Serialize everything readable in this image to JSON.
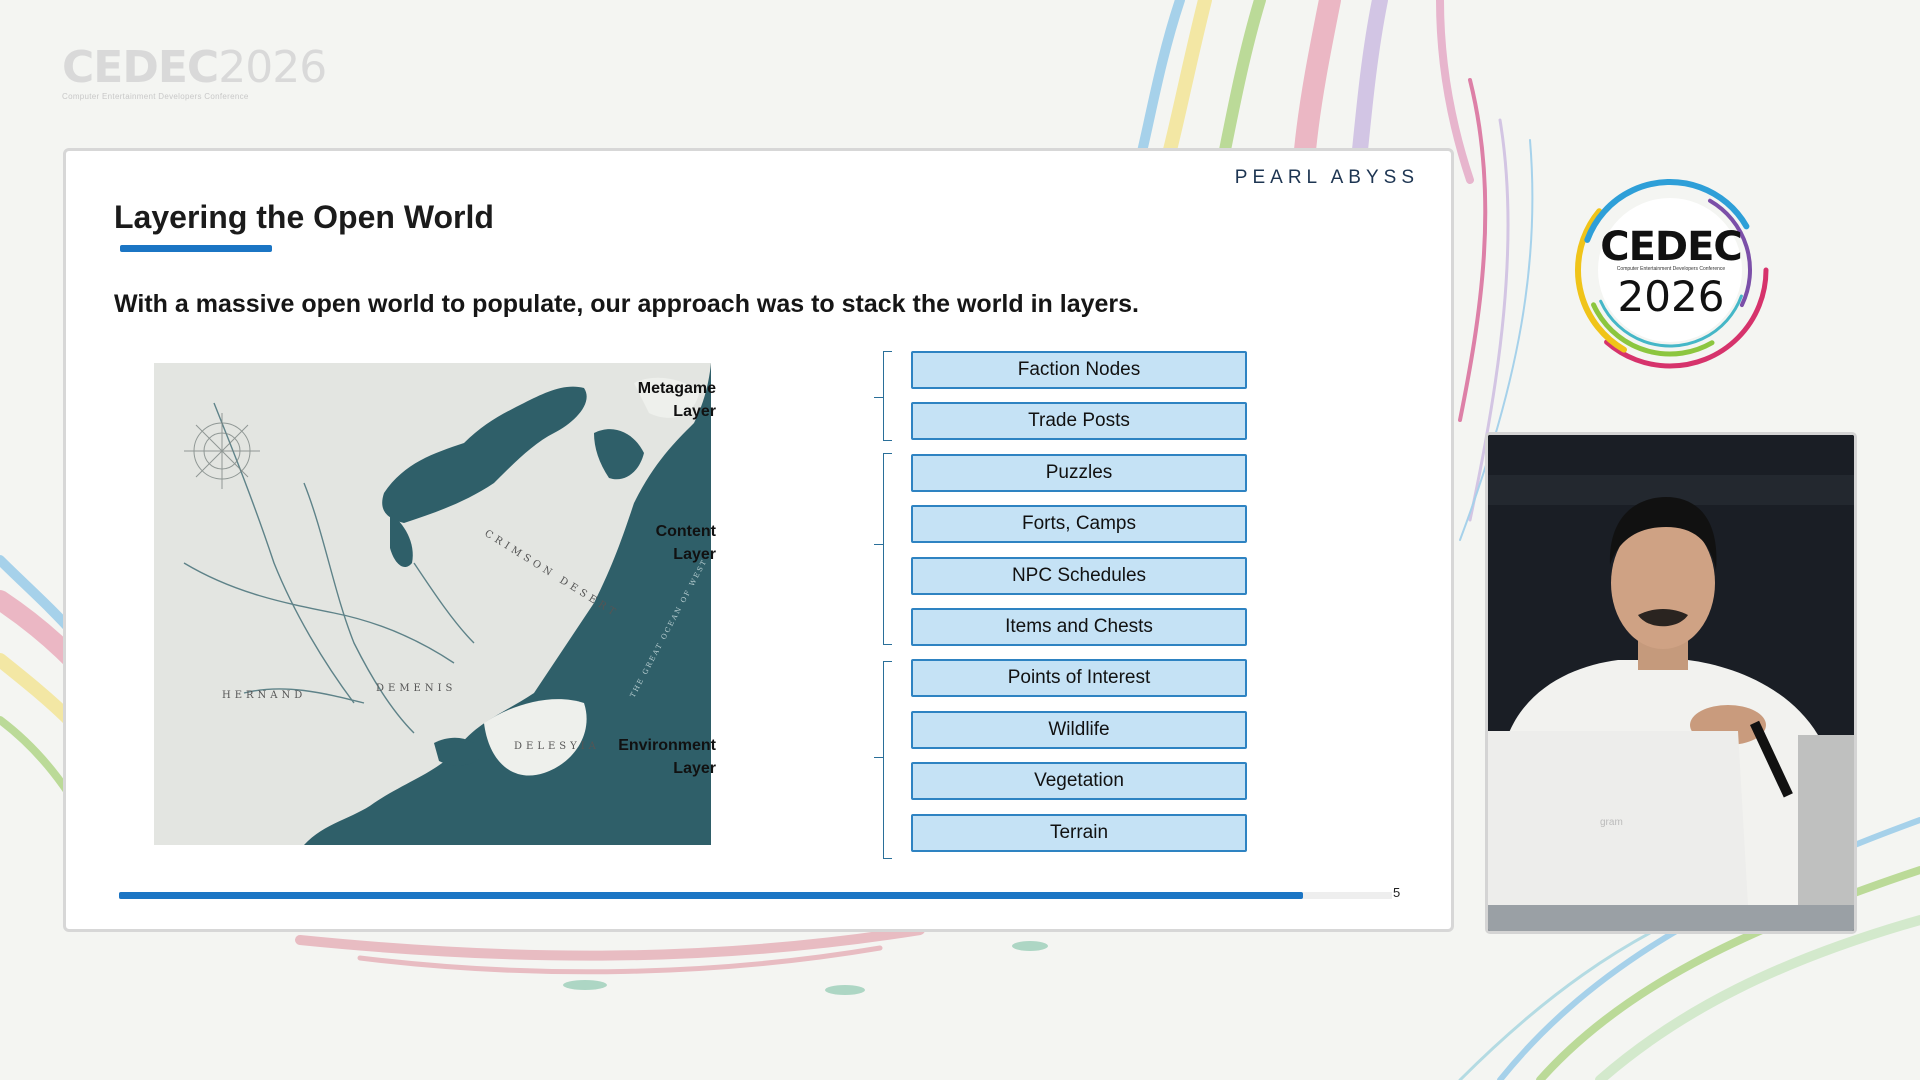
{
  "event": {
    "logo_text": "CEDEC",
    "logo_year": "2026",
    "logo_subtitle": "Computer Entertainment Developers Conference"
  },
  "slide": {
    "brand": "PEARL ABYSS",
    "title": "Layering the Open World",
    "lead": "With a massive open world to populate, our approach was to stack the world in layers.",
    "page_number": "5",
    "progress": 0.93,
    "map": {
      "labels": [
        "HERNAND",
        "DEMENIS",
        "DELESYIA",
        "CRIMSON DESERT",
        "THE GREAT OCEAN OF WEST"
      ]
    },
    "layers": [
      {
        "label_line1": "Metagame",
        "label_line2": "Layer",
        "items": [
          "Faction Nodes",
          "Trade Posts"
        ]
      },
      {
        "label_line1": "Content",
        "label_line2": "Layer",
        "items": [
          "Puzzles",
          "Forts, Camps",
          "NPC Schedules",
          "Items and Chests"
        ]
      },
      {
        "label_line1": "Environment",
        "label_line2": "Layer",
        "items": [
          "Points of Interest",
          "Wildlife",
          "Vegetation",
          "Terrain"
        ]
      }
    ]
  },
  "video": {
    "laptop_brand": "gram"
  },
  "colors": {
    "accent_blue": "#1b75c4",
    "box_fill": "#c5e2f5",
    "box_border": "#2e83c2",
    "map_sea": "#2f5f69",
    "map_land": "#e3e5e1"
  }
}
